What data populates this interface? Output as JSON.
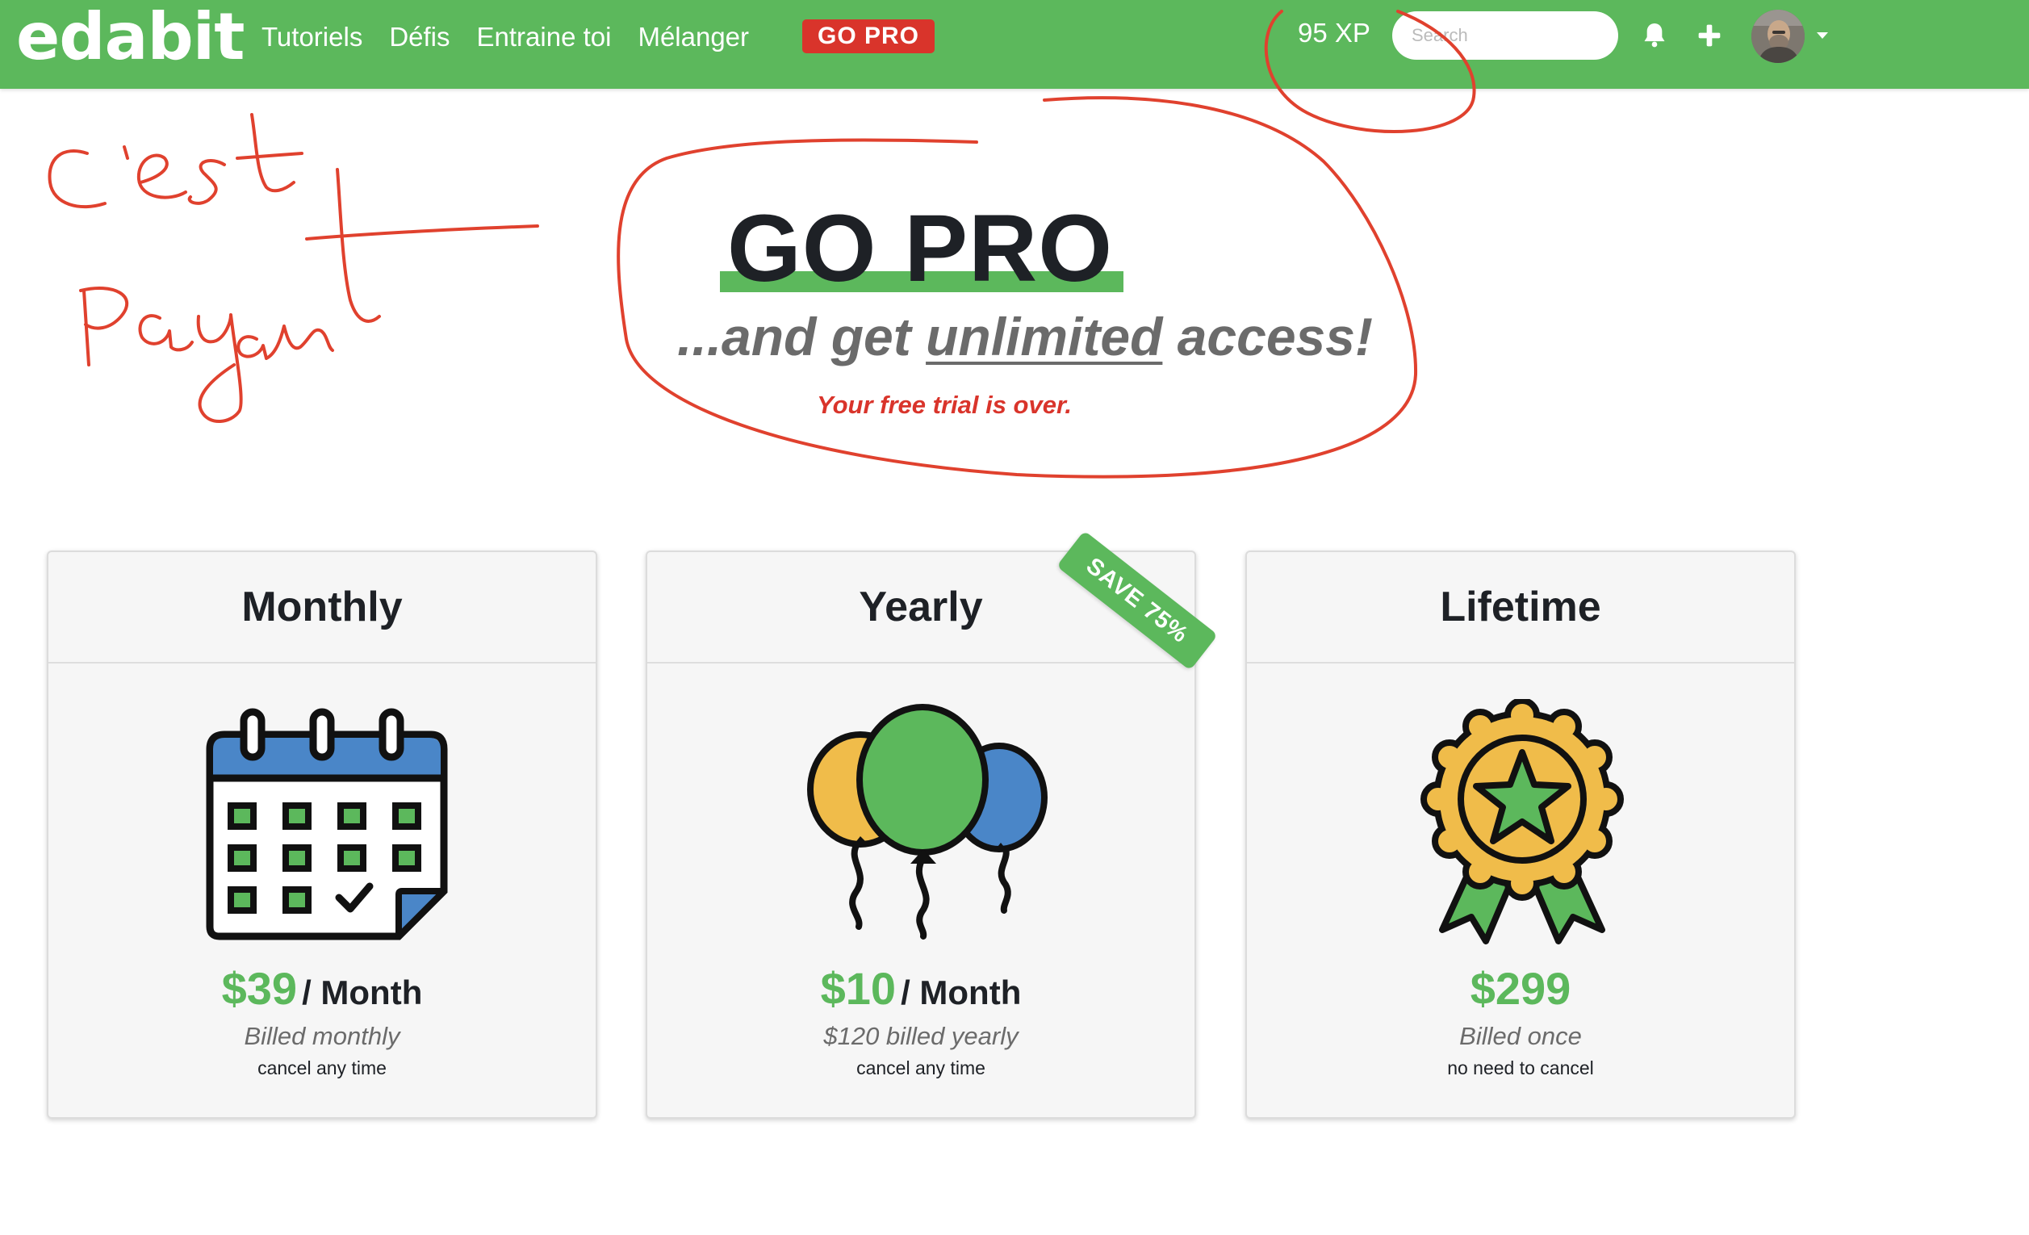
{
  "navbar": {
    "logo": "edabit",
    "links": [
      "Tutoriels",
      "Défis",
      "Entraine toi",
      "Mélanger"
    ],
    "go_pro": "GO PRO",
    "xp": "95 XP",
    "search_placeholder": "Search",
    "icons": [
      "bell-icon",
      "plus-icon",
      "avatar",
      "caret-down-icon"
    ]
  },
  "annotations": {
    "handwriting_line1": "c'est",
    "handwriting_line2": "Payant",
    "ink_color": "#e0412e"
  },
  "hero": {
    "title": "GO PRO",
    "subtitle_pre": "...and get ",
    "subtitle_emph": "unlimited",
    "subtitle_post": " access!",
    "trial_notice": "Your free trial is over."
  },
  "plans": [
    {
      "name": "Monthly",
      "icon": "calendar-icon",
      "price": "$39",
      "per": "/ Month",
      "billed": "Billed monthly",
      "note": "cancel any time"
    },
    {
      "name": "Yearly",
      "icon": "balloons-icon",
      "price": "$10",
      "per": "/ Month",
      "billed": "$120 billed yearly",
      "note": "cancel any time",
      "badge": "SAVE 75%"
    },
    {
      "name": "Lifetime",
      "icon": "award-badge-icon",
      "price": "$299",
      "per": "",
      "billed": "Billed once",
      "note": "no need to cancel"
    }
  ],
  "colors": {
    "brand_green": "#5cb85c",
    "go_pro_red": "#d9342b",
    "calendar_blue": "#4a86c8",
    "balloon_yellow": "#f0bc4a",
    "balloon_blue": "#4a86c8",
    "text_dark": "#1e2126",
    "text_gray": "#6b6b6b"
  }
}
